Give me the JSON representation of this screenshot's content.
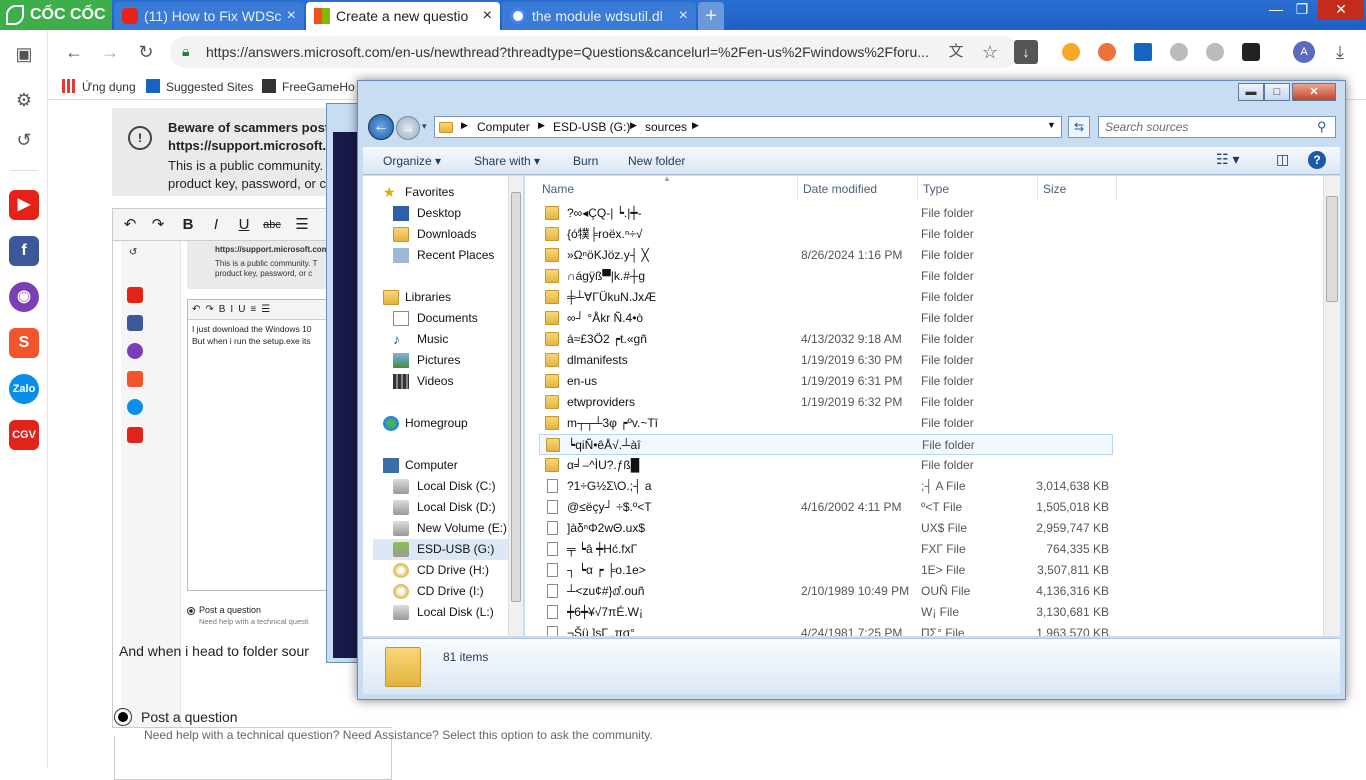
{
  "browser": {
    "brand": "CỐC CỐC",
    "tabs": [
      {
        "label": "(11) How to Fix WDSc",
        "icon": "youtube-icon",
        "active": false
      },
      {
        "label": "Create a new questio",
        "icon": "microsoft-icon",
        "active": true
      },
      {
        "label": "the module wdsutil.dl",
        "icon": "google-icon",
        "active": false
      }
    ],
    "new_tab": "+",
    "url": "https://answers.microsoft.com/en-us/newthread?threadtype=Questions&cancelurl=%2Fen-us%2Fwindows%2Fforu...",
    "bookmarks": [
      "Ứng dụng",
      "Suggested Sites",
      "FreeGameHo"
    ],
    "profile_initial": "A"
  },
  "page": {
    "warning_title": "Beware of scammers posti",
    "warning_link": "https://support.microsoft.c",
    "warning_body_1": "This is a public community.",
    "warning_body_2": "product key, password, or c",
    "editor_text_1": "I just download the Windows 10",
    "editor_text_2": "But when i run the setup.exe its",
    "inner_link": "https://support.microsoft.com",
    "inner_body_1": "This is a public community. T",
    "inner_body_2": "product key, password, or c",
    "inner_post_label": "Post a question",
    "inner_post_desc": "Need help with a technical questi",
    "body_line": "And when i head to folder sour",
    "post_question_label": "Post a question",
    "post_question_desc": "Need help with a technical question? Need Assistance? Select this option to ask the community."
  },
  "explorer": {
    "breadcrumb": [
      "Computer",
      "ESD-USB (G:)",
      "sources"
    ],
    "search_placeholder": "Search sources",
    "commands": [
      "Organize",
      "Share with",
      "Burn",
      "New folder"
    ],
    "columns": [
      "Name",
      "Date modified",
      "Type",
      "Size"
    ],
    "nav": {
      "favorites": "Favorites",
      "favorites_items": [
        "Desktop",
        "Downloads",
        "Recent Places"
      ],
      "libraries": "Libraries",
      "libraries_items": [
        "Documents",
        "Music",
        "Pictures",
        "Videos"
      ],
      "homegroup": "Homegroup",
      "computer": "Computer",
      "drives": [
        "Local Disk (C:)",
        "Local Disk (D:)",
        "New Volume (E:)",
        "ESD-USB (G:)",
        "CD Drive (H:)",
        "CD Drive (I:)",
        "Local Disk (L:)"
      ]
    },
    "files": [
      {
        "name": "?∞◂ÇQ-| ┕.|┿-",
        "date": "",
        "type": "File folder",
        "size": "",
        "kind": "folder"
      },
      {
        "name": "{ó㹒╞roëx.ⁿ÷√",
        "date": "",
        "type": "File folder",
        "size": "",
        "kind": "folder"
      },
      {
        "name": "»ΩⁿöKJöz.y┤ ╳",
        "date": "8/26/2024 1:16 PM",
        "type": "File folder",
        "size": "",
        "kind": "folder"
      },
      {
        "name": "∩ágÿß▀|k.#┼g",
        "date": "",
        "type": "File folder",
        "size": "",
        "kind": "folder"
      },
      {
        "name": "╪┴∀ΓÜkuN.JxÆ",
        "date": "",
        "type": "File folder",
        "size": "",
        "kind": "folder"
      },
      {
        "name": "∞┘ °Åkr Ñ.4•ò",
        "date": "",
        "type": "File folder",
        "size": "",
        "kind": "folder"
      },
      {
        "name": "á≈£3Ö2 ┍t.«gñ",
        "date": "4/13/2032 9:18 AM",
        "type": "File folder",
        "size": "",
        "kind": "folder"
      },
      {
        "name": "dlmanifests",
        "date": "1/19/2019 6:30 PM",
        "type": "File folder",
        "size": "",
        "kind": "folder"
      },
      {
        "name": "en-us",
        "date": "1/19/2019 6:31 PM",
        "type": "File folder",
        "size": "",
        "kind": "folder"
      },
      {
        "name": "etwproviders",
        "date": "1/19/2019 6:32 PM",
        "type": "File folder",
        "size": "",
        "kind": "folder"
      },
      {
        "name": "m┬┬┴3φ ┍ºv.~Tî",
        "date": "",
        "type": "File folder",
        "size": "",
        "kind": "folder"
      },
      {
        "name": "┕qiÑ•êÅ√.┴àî",
        "date": "",
        "type": "File folder",
        "size": "",
        "kind": "folder"
      },
      {
        "name": "α╛–^ÌU?.ƒß█",
        "date": "",
        "type": "File folder",
        "size": "",
        "kind": "folder"
      },
      {
        "name": "?1÷G½Σ\\O.;┤ a",
        "date": "",
        "type": ";┤ A File",
        "size": "3,014,638 KB",
        "kind": "file"
      },
      {
        "name": "@≤ëçy┘ ÷$.º<T",
        "date": "4/16/2002 4:11 PM",
        "type": "º<T File",
        "size": "1,505,018 KB",
        "kind": "file"
      },
      {
        "name": "]àδⁿΦ2wΘ.ux$",
        "date": "",
        "type": "UX$ File",
        "size": "2,959,747 KB",
        "kind": "file"
      },
      {
        "name": " ╤ ┕â ┿Hć.fxΓ",
        "date": "",
        "type": "FXΓ File",
        "size": "764,335 KB",
        "kind": "file"
      },
      {
        "name": "┐ ┕α ┍ ╞o.1e>",
        "date": "",
        "type": "1E> File",
        "size": "3,507,811 KB",
        "kind": "file"
      },
      {
        "name": "┴<zu¢#}ⅆ.ouñ",
        "date": "2/10/1989 10:49 PM",
        "type": "OUÑ File",
        "size": "4,136,316 KB",
        "kind": "file"
      },
      {
        "name": "┿6┿¥√7πÉ.W¡",
        "date": "",
        "type": "W¡ File",
        "size": "3,130,681 KB",
        "kind": "file"
      },
      {
        "name": "¬Šü ]sΓ .πσ°",
        "date": "4/24/1981 7:25 PM",
        "type": "ΠΣ° File",
        "size": "1,963,570 KB",
        "kind": "file"
      }
    ],
    "item_count": "81 items"
  },
  "colors": {
    "coccoc_green": "#3dae49",
    "chrome_blue": "#2a6fd4",
    "win7_frame": "#c8dcf2",
    "folder_yellow": "#e3b341"
  }
}
